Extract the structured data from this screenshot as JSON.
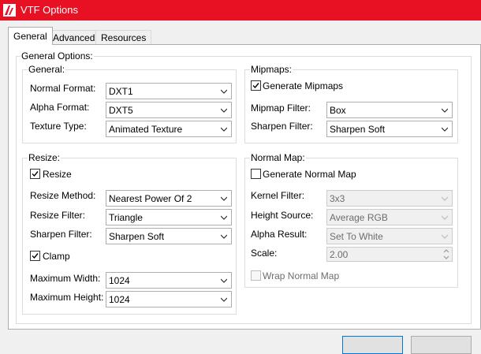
{
  "window": {
    "title": "VTF Options"
  },
  "tabs": [
    {
      "label": "General"
    },
    {
      "label": "Advanced"
    },
    {
      "label": "Resources"
    }
  ],
  "general_options": {
    "legend": "General Options:",
    "general": {
      "legend": "General:",
      "normal_format": {
        "label": "Normal Format:",
        "value": "DXT1"
      },
      "alpha_format": {
        "label": "Alpha Format:",
        "value": "DXT5"
      },
      "texture_type": {
        "label": "Texture Type:",
        "value": "Animated Texture"
      }
    },
    "mipmaps": {
      "legend": "Mipmaps:",
      "generate": {
        "label": "Generate Mipmaps",
        "checked": true
      },
      "filter": {
        "label": "Mipmap Filter:",
        "value": "Box"
      },
      "sharpen": {
        "label": "Sharpen Filter:",
        "value": "Sharpen Soft"
      }
    },
    "resize": {
      "legend": "Resize:",
      "resize": {
        "label": "Resize",
        "checked": true
      },
      "method": {
        "label": "Resize Method:",
        "value": "Nearest Power Of 2"
      },
      "filter": {
        "label": "Resize Filter:",
        "value": "Triangle"
      },
      "sharpen": {
        "label": "Sharpen Filter:",
        "value": "Sharpen Soft"
      },
      "clamp": {
        "label": "Clamp",
        "checked": true
      },
      "max_width": {
        "label": "Maximum Width:",
        "value": "1024"
      },
      "max_height": {
        "label": "Maximum Height:",
        "value": "1024"
      }
    },
    "normal_map": {
      "legend": "Normal Map:",
      "generate": {
        "label": "Generate Normal Map",
        "checked": false
      },
      "kernel": {
        "label": "Kernel Filter:",
        "value": "3x3"
      },
      "height_source": {
        "label": "Height Source:",
        "value": "Average RGB"
      },
      "alpha_result": {
        "label": "Alpha Result:",
        "value": "Set To White"
      },
      "scale": {
        "label": "Scale:",
        "value": "2.00"
      },
      "wrap": {
        "label": "Wrap Normal Map",
        "checked": false
      }
    }
  },
  "colors": {
    "titlebar": "#e81123",
    "accent": "#0078d7"
  }
}
